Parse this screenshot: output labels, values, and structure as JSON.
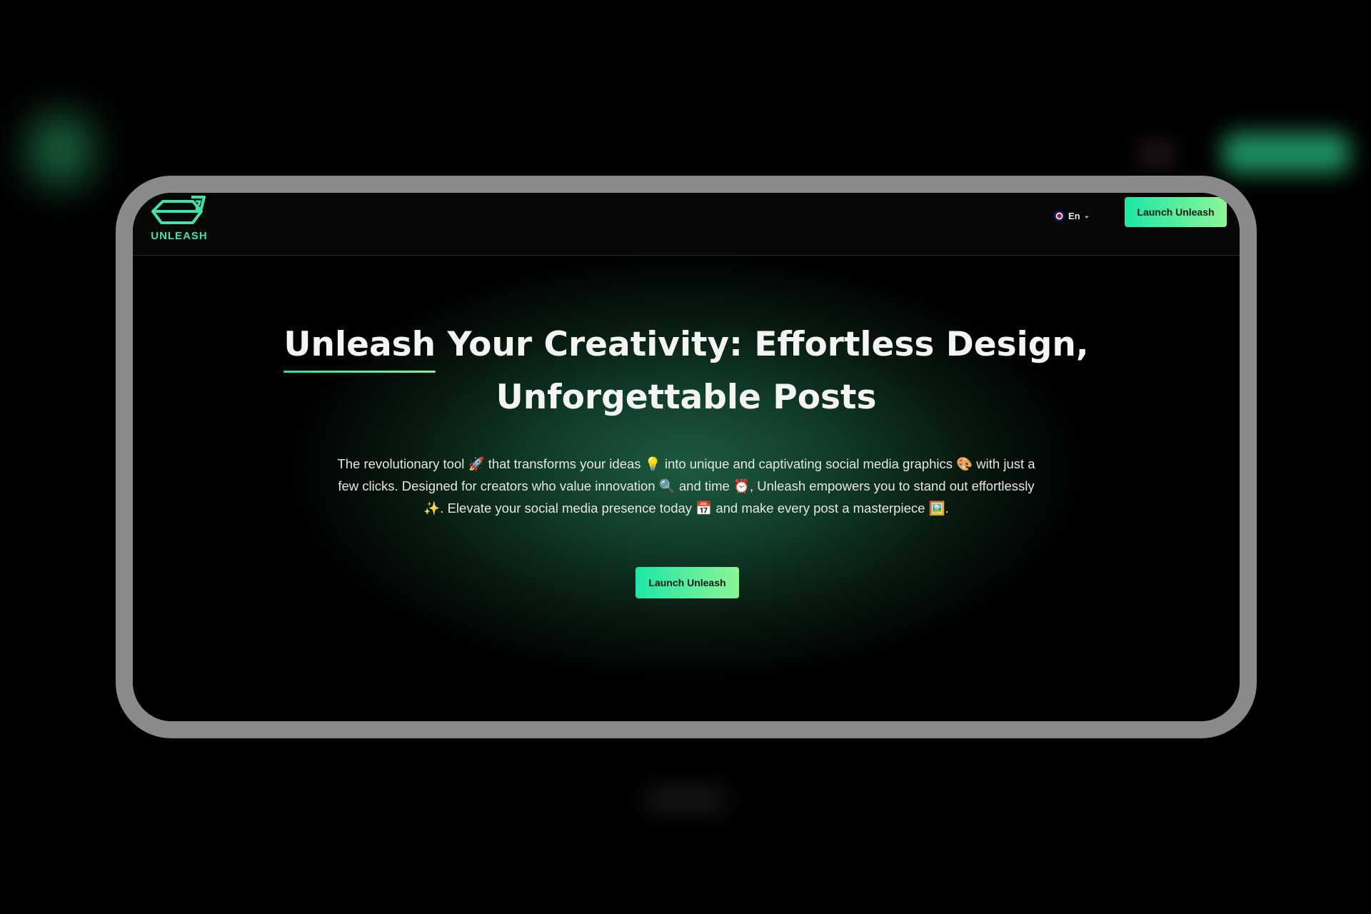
{
  "brand": {
    "name": "UNLEASH",
    "accent": "#3fe2a8",
    "button_gradient": [
      "#1ee6a8",
      "#8cf596"
    ]
  },
  "header": {
    "language_label": "En",
    "language_icon": "uk-flag-icon",
    "chevron_icon": "chevron-down-icon",
    "launch_label": "Launch Unleash"
  },
  "hero": {
    "title_highlight": "Unleash",
    "title_rest": " Your Creativity: Effortless Design, Unforgettable Posts",
    "description": "The revolutionary tool 🚀 that transforms your ideas 💡 into unique and captivating social media graphics 🎨 with just a few clicks. Designed for creators who value innovation 🔍 and time ⏰, Unleash empowers you to stand out effortlessly ✨. Elevate your social media presence today 📅 and make every post a masterpiece 🖼️.",
    "launch_label": "Launch Unleash"
  }
}
